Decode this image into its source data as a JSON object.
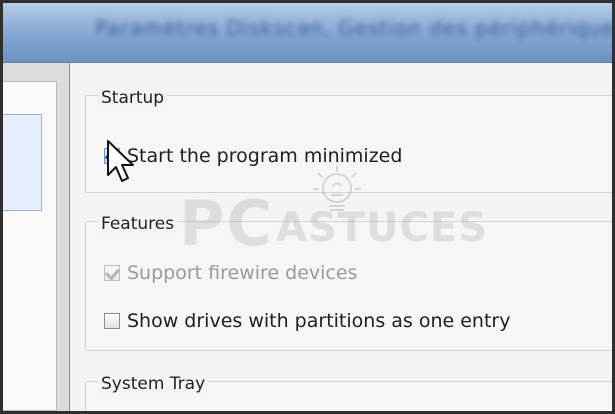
{
  "window": {
    "title_text": "Paramètres Diskscan, Gestion des périphériques"
  },
  "groups": {
    "startup": {
      "label": "Startup",
      "items": [
        {
          "label": "Start the program minimized",
          "checked": true,
          "disabled": false
        }
      ]
    },
    "features": {
      "label": "Features",
      "items": [
        {
          "label": "Support firewire devices",
          "checked": true,
          "disabled": true
        },
        {
          "label": "Show drives with partitions as one entry",
          "checked": false,
          "disabled": false
        }
      ]
    },
    "system_tray": {
      "label": "System Tray"
    }
  },
  "watermark": {
    "brand_text": "PC",
    "subtitle_text": "ASTUCES"
  }
}
